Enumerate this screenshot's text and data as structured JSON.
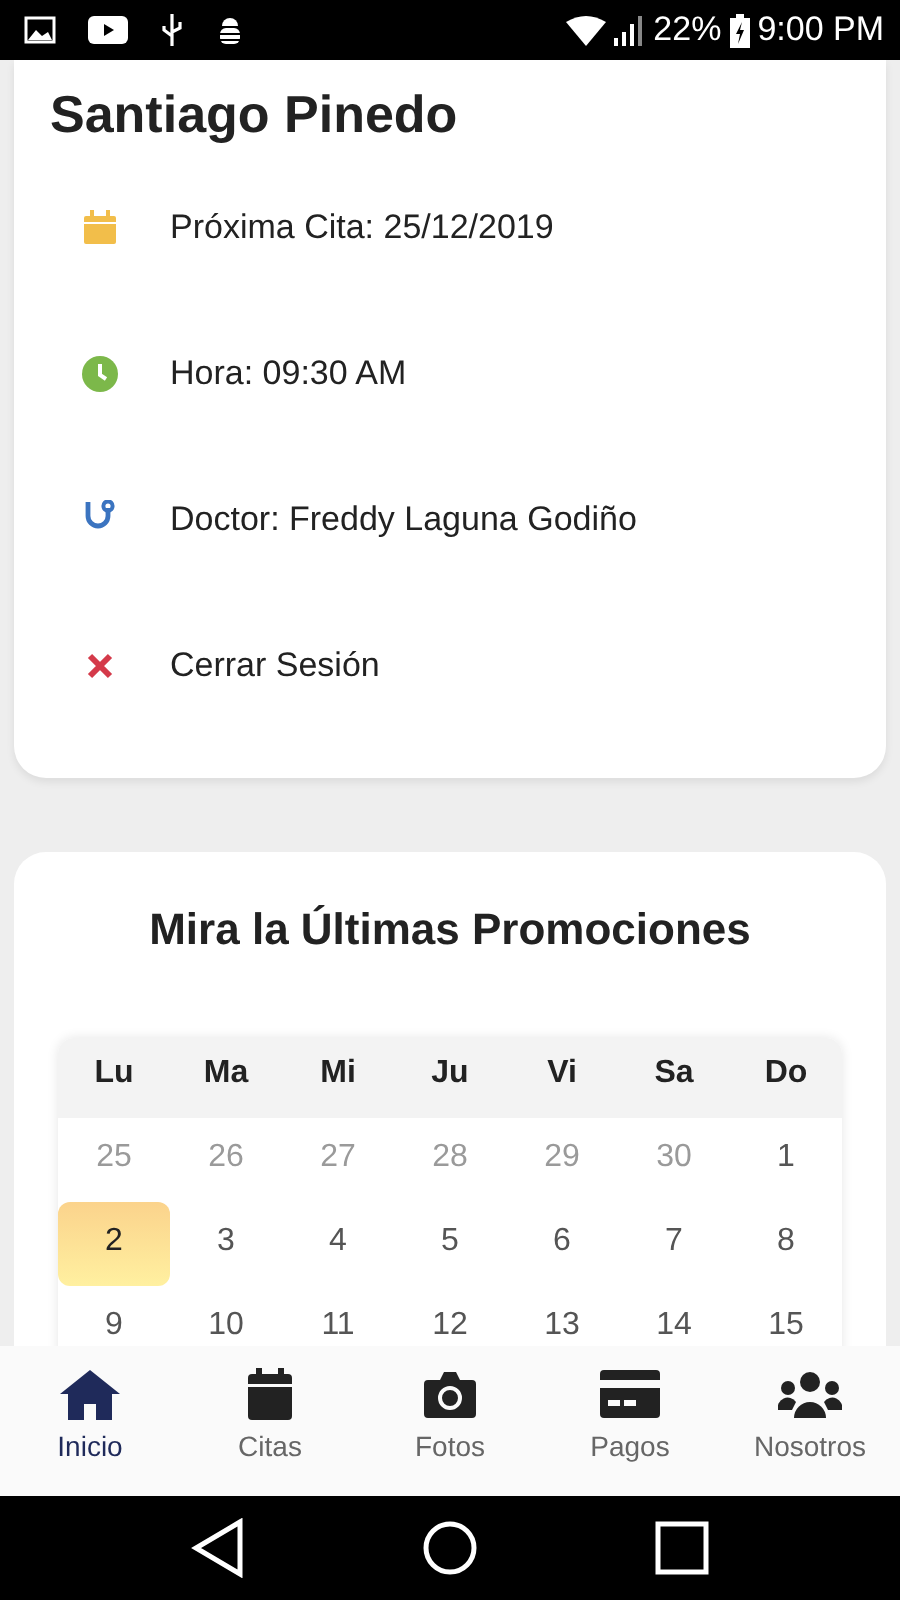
{
  "status_bar": {
    "battery": "22%",
    "time": "9:00 PM"
  },
  "profile": {
    "name": "Santiago Pinedo",
    "items": [
      {
        "kind": "calendar",
        "text": "Próxima Cita: 25/12/2019"
      },
      {
        "kind": "clock",
        "text": "Hora: 09:30 AM"
      },
      {
        "kind": "doctor",
        "text": "Doctor: Freddy Laguna Godiño"
      },
      {
        "kind": "logout",
        "text": "Cerrar Sesión"
      }
    ]
  },
  "promotions": {
    "title": "Mira la Últimas Promociones",
    "calendar": {
      "weekdays": [
        "Lu",
        "Ma",
        "Mi",
        "Ju",
        "Vi",
        "Sa",
        "Do"
      ],
      "weeks": [
        [
          {
            "day": "25",
            "muted": true,
            "selected": false
          },
          {
            "day": "26",
            "muted": true,
            "selected": false
          },
          {
            "day": "27",
            "muted": true,
            "selected": false
          },
          {
            "day": "28",
            "muted": true,
            "selected": false
          },
          {
            "day": "29",
            "muted": true,
            "selected": false
          },
          {
            "day": "30",
            "muted": true,
            "selected": false
          },
          {
            "day": "1",
            "muted": false,
            "selected": false
          }
        ],
        [
          {
            "day": "2",
            "muted": false,
            "selected": true
          },
          {
            "day": "3",
            "muted": false,
            "selected": false
          },
          {
            "day": "4",
            "muted": false,
            "selected": false
          },
          {
            "day": "5",
            "muted": false,
            "selected": false
          },
          {
            "day": "6",
            "muted": false,
            "selected": false
          },
          {
            "day": "7",
            "muted": false,
            "selected": false
          },
          {
            "day": "8",
            "muted": false,
            "selected": false
          }
        ],
        [
          {
            "day": "9",
            "muted": false,
            "selected": false
          },
          {
            "day": "10",
            "muted": false,
            "selected": false
          },
          {
            "day": "11",
            "muted": false,
            "selected": false
          },
          {
            "day": "12",
            "muted": false,
            "selected": false
          },
          {
            "day": "13",
            "muted": false,
            "selected": false
          },
          {
            "day": "14",
            "muted": false,
            "selected": false
          },
          {
            "day": "15",
            "muted": false,
            "selected": false
          }
        ]
      ]
    }
  },
  "tabs": [
    {
      "kind": "home",
      "label": "Inicio",
      "selected": true
    },
    {
      "kind": "calendar",
      "label": "Citas",
      "selected": false
    },
    {
      "kind": "camera",
      "label": "Fotos",
      "selected": false
    },
    {
      "kind": "card",
      "label": "Pagos",
      "selected": false
    },
    {
      "kind": "users",
      "label": "Nosotros",
      "selected": false
    }
  ]
}
